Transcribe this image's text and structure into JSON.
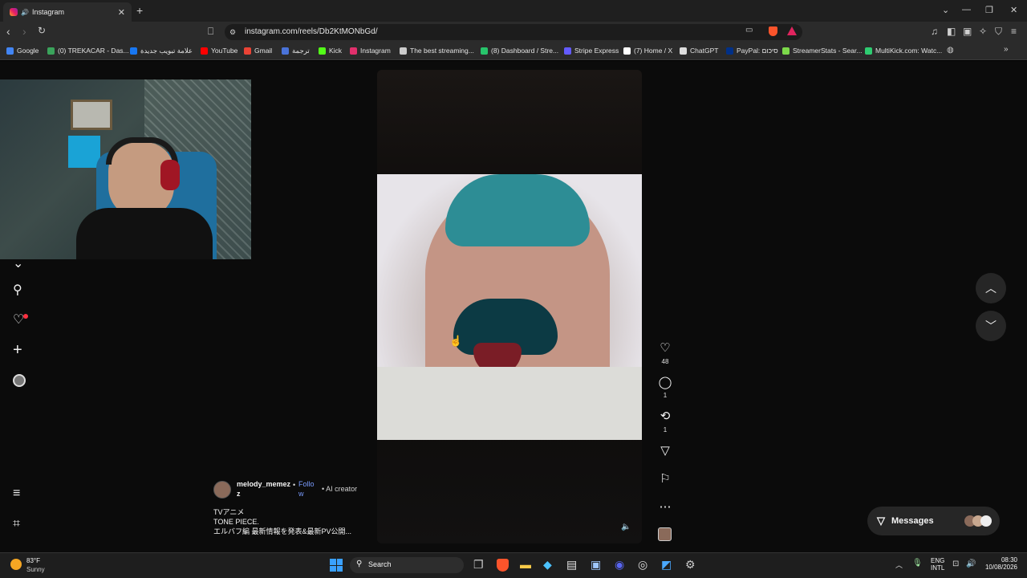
{
  "browser": {
    "tab_title": "Instagram",
    "tab_close": "✕",
    "new_tab": "+",
    "url": "instagram.com/reels/Db2KtMONbGd/",
    "window_controls": [
      "⌄",
      "—",
      "❐",
      "✕"
    ]
  },
  "bookmarks": [
    {
      "label": "Google",
      "color": "#4285f4"
    },
    {
      "label": "(0) TREKACAR - Das...",
      "color": "#3aa35b"
    },
    {
      "label": "علامة تبويب جديدة",
      "color": "#1877f2"
    },
    {
      "label": "YouTube",
      "color": "#ff0000"
    },
    {
      "label": "Gmail",
      "color": "#ea4335"
    },
    {
      "label": "ترجمة",
      "color": "#4a73d9"
    },
    {
      "label": "Kick",
      "color": "#53fc18"
    },
    {
      "label": "Instagram",
      "color": "#e1306c"
    },
    {
      "label": "The best streaming...",
      "color": "#cccccc"
    },
    {
      "label": "(8) Dashboard / Stre...",
      "color": "#27c46b"
    },
    {
      "label": "Stripe Express",
      "color": "#635bff"
    },
    {
      "label": "(7) Home / X",
      "color": "#ffffff"
    },
    {
      "label": "ChatGPT",
      "color": "#dddddd"
    },
    {
      "label": "PayPal: סיכום",
      "color": "#003087"
    },
    {
      "label": "StreamerStats - Sear...",
      "color": "#7cd94a"
    },
    {
      "label": "MultiKick.com: Watc...",
      "color": "#2ecc71"
    }
  ],
  "reel": {
    "username": "melody_memez",
    "username_tail": "z",
    "follow": "Follo",
    "follow_tail": "w",
    "separator": "•",
    "creator_badge": "AI creator",
    "caption_lines": [
      "TVアニメ",
      "TONE PIECE.",
      "エルバフ編 最新情報を発表&最新PV公開..."
    ],
    "likes": "48",
    "comments": "1",
    "reposts": "1"
  },
  "messages_label": "Messages",
  "taskbar": {
    "weather_temp": "83°F",
    "weather_desc": "Sunny",
    "search_placeholder": "Search",
    "lang_top": "ENG",
    "lang_bottom": "INTL",
    "time": "08:30",
    "date": "10/08/2026"
  }
}
